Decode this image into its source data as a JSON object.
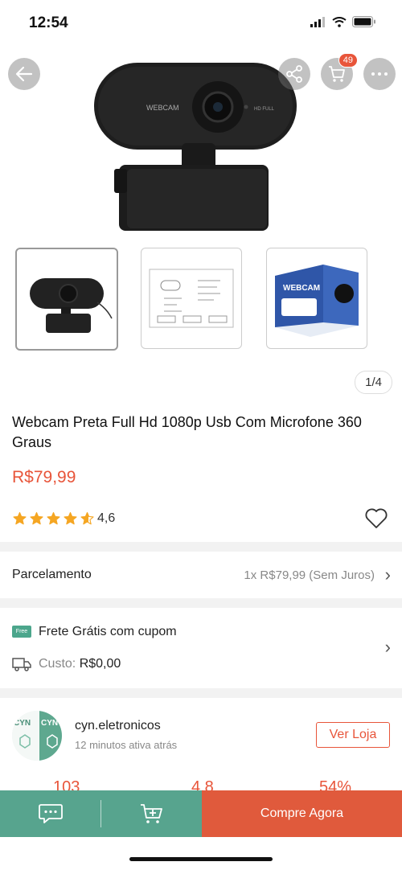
{
  "status_bar": {
    "time": "12:54"
  },
  "header": {
    "cart_count": "49"
  },
  "gallery": {
    "main_image_label": "WEBCAM",
    "main_image_tag": "HD FULL",
    "thumb3_label": "WEBCAM",
    "counter": "1/4"
  },
  "product": {
    "title": "Webcam Preta Full Hd 1080p Usb Com Microfone 360 Graus",
    "price": "R$79,99",
    "rating": "4,6",
    "rating_value": 4.6
  },
  "installments": {
    "label": "Parcelamento",
    "value": "1x R$79,99 (Sem Juros)"
  },
  "shipping": {
    "badge": "Free",
    "title": "Frete Grátis com cupom",
    "cost_label": "Custo:",
    "cost_value": "R$0,00"
  },
  "seller": {
    "avatar_text": "CYN",
    "name": "cyn.eletronicos",
    "active": "12 minutos ativa atrás",
    "store_button": "Ver Loja",
    "stats": [
      "103",
      "4,8",
      "54%"
    ]
  },
  "bottom_bar": {
    "buy_label": "Compre Agora"
  },
  "colors": {
    "accent": "#e8553a",
    "green": "#57a48e",
    "buy": "#e05a3c"
  }
}
